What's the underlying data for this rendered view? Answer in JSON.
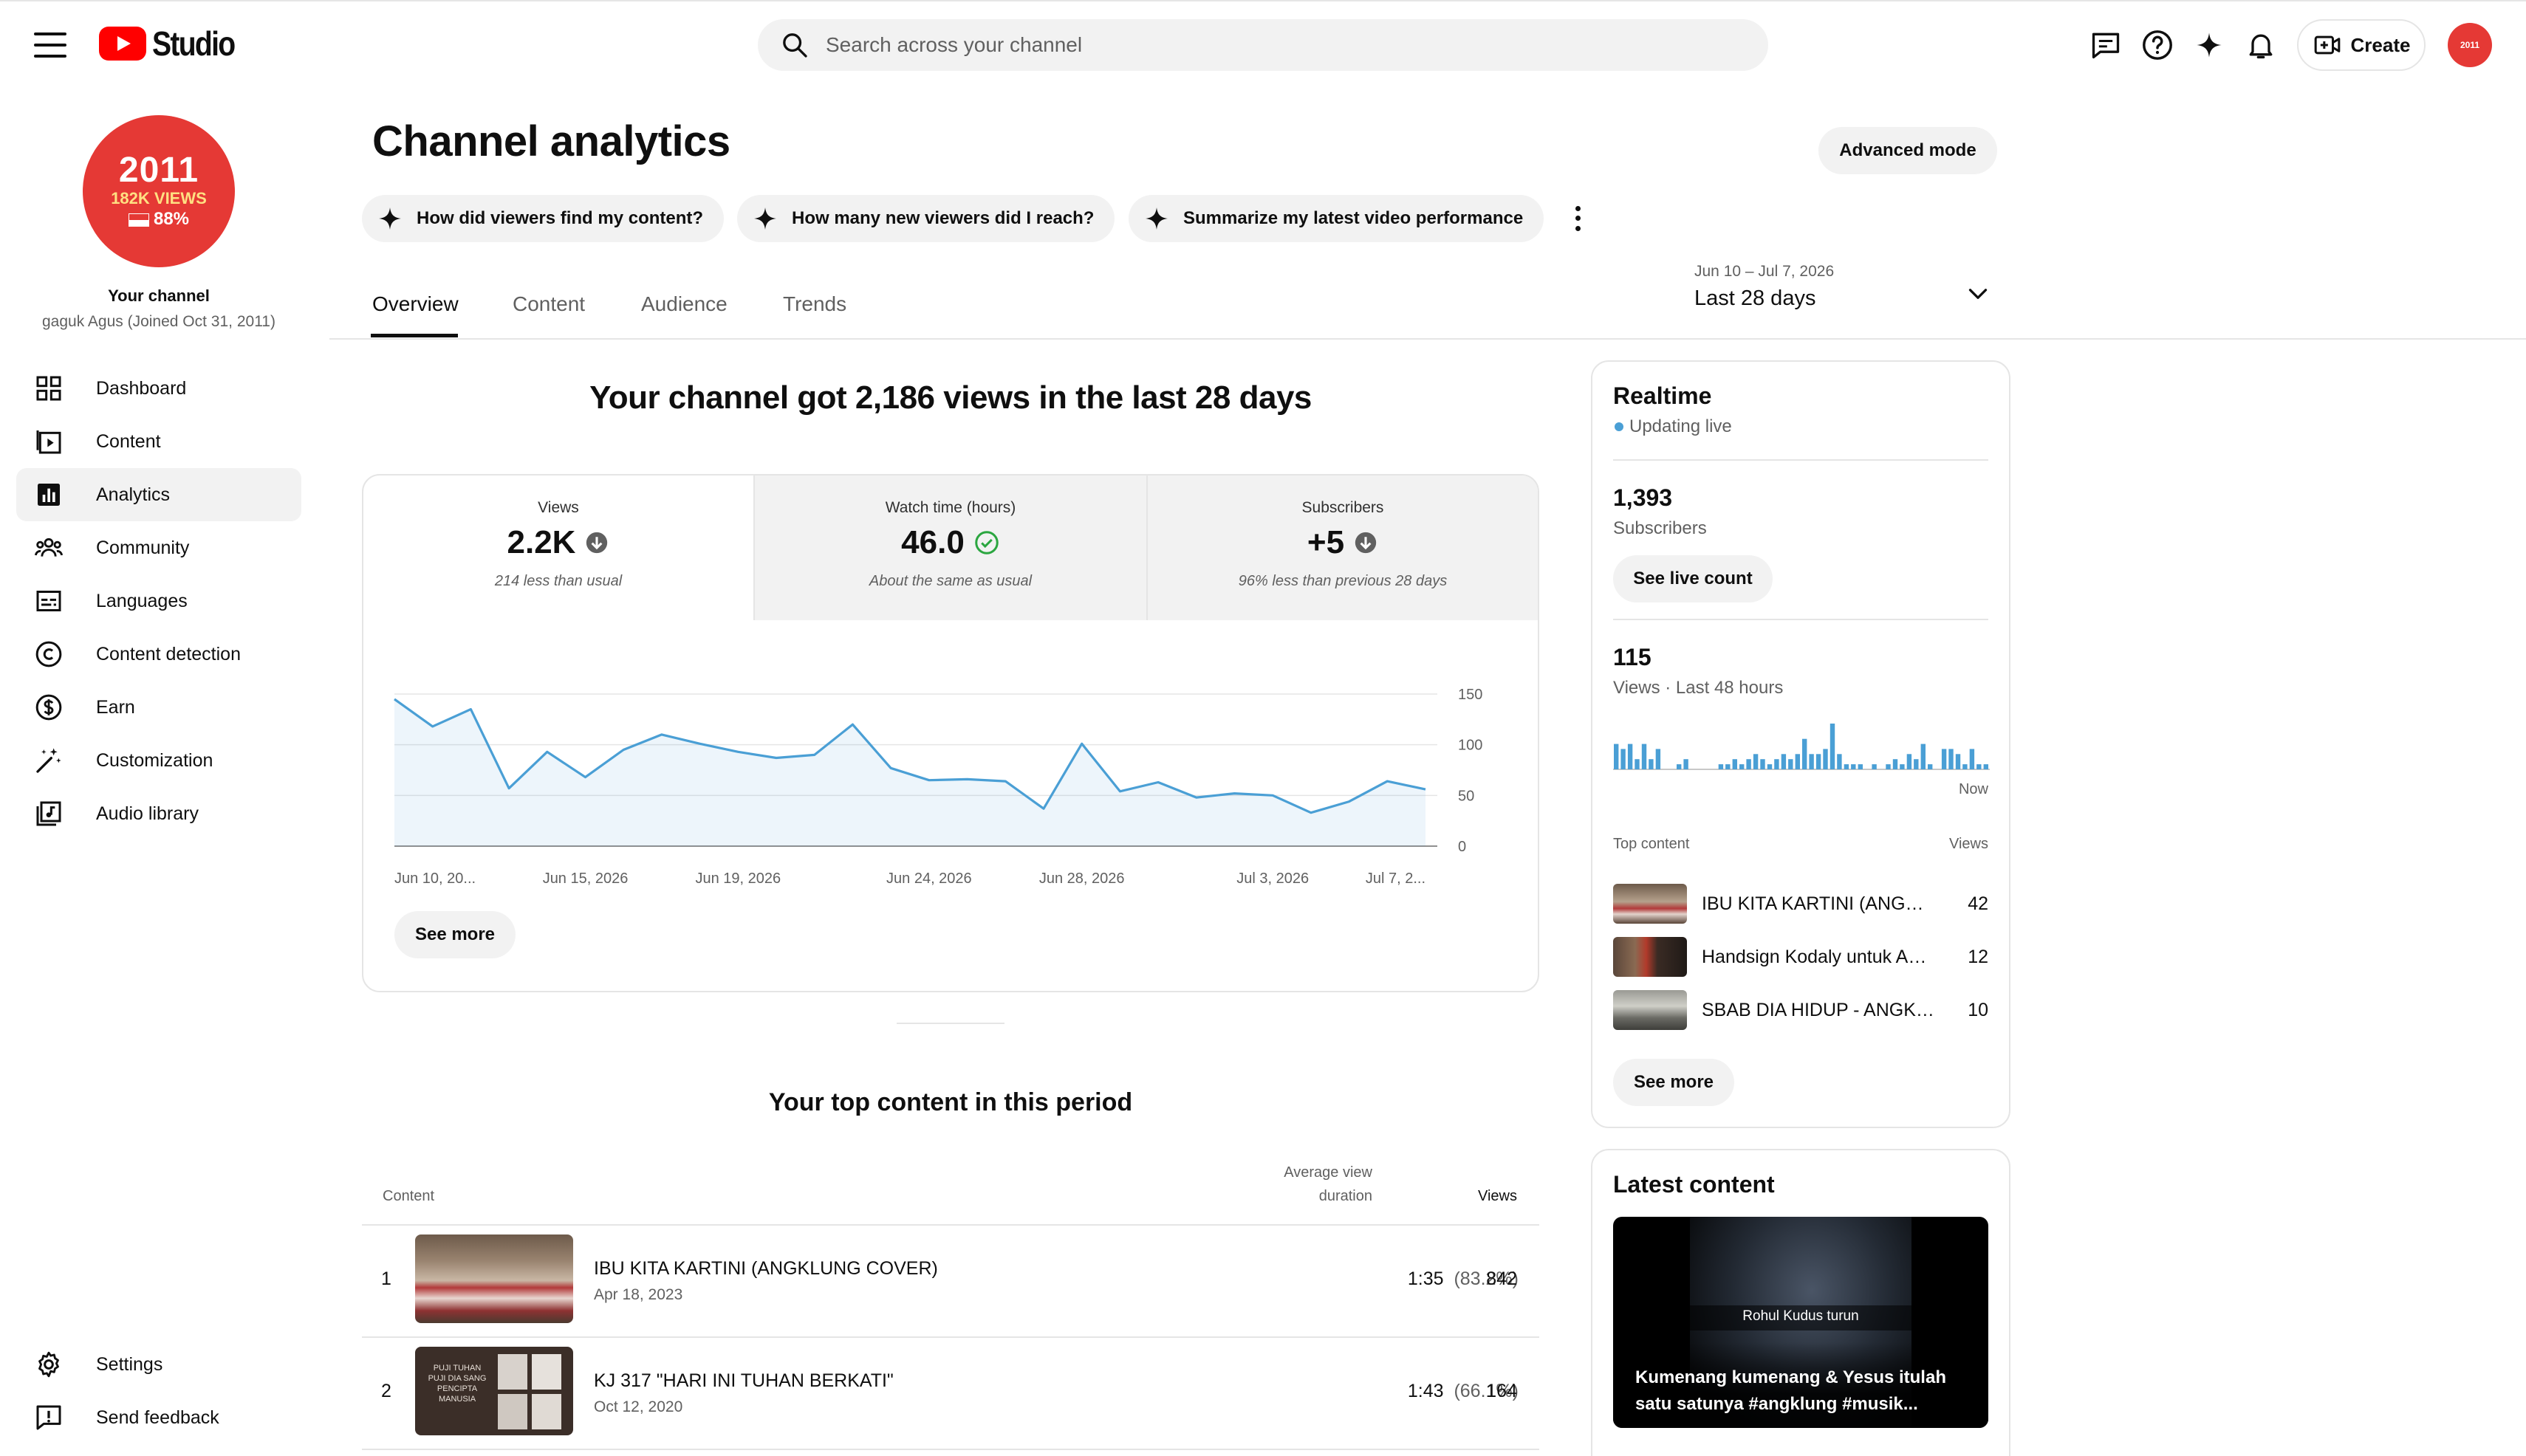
{
  "app": {
    "name": "Studio"
  },
  "search": {
    "placeholder": "Search across your channel"
  },
  "topbar": {
    "create_label": "Create",
    "avatar_text": "2011"
  },
  "channel": {
    "avatar": {
      "year": "2011",
      "views": "182K VIEWS",
      "pct": "88%"
    },
    "label": "Your channel",
    "name": "gaguk Agus (Joined Oct 31, 2011)"
  },
  "sidebar": {
    "items": [
      {
        "label": "Dashboard",
        "icon": "dashboard-icon"
      },
      {
        "label": "Content",
        "icon": "content-icon"
      },
      {
        "label": "Analytics",
        "icon": "analytics-icon",
        "active": true
      },
      {
        "label": "Community",
        "icon": "community-icon"
      },
      {
        "label": "Languages",
        "icon": "subtitles-icon"
      },
      {
        "label": "Content detection",
        "icon": "copyright-icon"
      },
      {
        "label": "Earn",
        "icon": "dollar-icon"
      },
      {
        "label": "Customization",
        "icon": "magic-wand-icon"
      },
      {
        "label": "Audio library",
        "icon": "audio-library-icon"
      }
    ],
    "footer": [
      {
        "label": "Settings",
        "icon": "gear-icon"
      },
      {
        "label": "Send feedback",
        "icon": "feedback-icon"
      }
    ]
  },
  "page": {
    "title": "Channel analytics",
    "advanced_mode": "Advanced mode",
    "chips": [
      "How did viewers find my content?",
      "How many new viewers did I reach?",
      "Summarize my latest video performance"
    ],
    "tabs": [
      "Overview",
      "Content",
      "Audience",
      "Trends"
    ],
    "date_range": {
      "range": "Jun 10 – Jul 7, 2026",
      "label": "Last 28 days"
    }
  },
  "overview": {
    "headline": "Your channel got 2,186 views in the last 28 days",
    "metrics": [
      {
        "title": "Views",
        "value": "2.2K",
        "status": "down",
        "sub": "214 less than usual"
      },
      {
        "title": "Watch time (hours)",
        "value": "46.0",
        "status": "ok",
        "sub": "About the same as usual"
      },
      {
        "title": "Subscribers",
        "value": "+5",
        "status": "down",
        "sub": "96% less than previous 28 days"
      }
    ],
    "see_more": "See more"
  },
  "chart_data": {
    "type": "area",
    "title": "",
    "xlabel": "",
    "ylabel": "",
    "x_ticks": [
      "Jun 10, 20...",
      "Jun 15, 2026",
      "Jun 19, 2026",
      "Jun 24, 2026",
      "Jun 28, 2026",
      "Jul 3, 2026",
      "Jul 7, 2..."
    ],
    "y_ticks": [
      "150",
      "100",
      "50",
      "0"
    ],
    "ylim": [
      0,
      150
    ],
    "grid": true,
    "series": [
      {
        "values": [
          145,
          118,
          135,
          57,
          93,
          68,
          95,
          110,
          101,
          93,
          87,
          90,
          120,
          77,
          65,
          66,
          64,
          37,
          101,
          54,
          63,
          48,
          52,
          50,
          33,
          44,
          64,
          56
        ]
      }
    ]
  },
  "top_content": {
    "title": "Your top content in this period",
    "headers": {
      "content": "Content",
      "avg_view_duration": "Average view duration",
      "views": "Views"
    },
    "rows": [
      {
        "rank": "1",
        "title": "IBU KITA KARTINI (ANGKLUNG COVER)",
        "date": "Apr 18, 2023",
        "duration": "1:35",
        "pct": "(83.2%)",
        "views": "842"
      },
      {
        "rank": "2",
        "title": "KJ 317 \"HARI INI TUHAN BERKATI\"",
        "date": "Oct 12, 2020",
        "duration": "1:43",
        "pct": "(66.1%)",
        "views": "164",
        "thumb_text": "PUJI TUHAN PUJI DIA SANG PENCIPTA MANUSIA"
      }
    ]
  },
  "realtime": {
    "title": "Realtime",
    "status": "Updating live",
    "subscribers_value": "1,393",
    "subscribers_label": "Subscribers",
    "live_count_btn": "See live count",
    "views_value": "115",
    "views_label": "Views · Last 48 hours",
    "now_label": "Now",
    "bars": [
      5,
      4,
      5,
      2,
      5,
      2,
      4,
      0,
      0,
      1,
      2,
      0,
      0,
      0,
      0,
      1,
      1,
      2,
      1,
      2,
      3,
      2,
      1,
      2,
      3,
      2,
      3,
      6,
      3,
      3,
      4,
      9,
      3,
      1,
      1,
      1,
      0,
      1,
      0,
      1,
      2,
      1,
      3,
      2,
      5,
      1,
      0,
      4,
      4,
      3,
      1,
      4,
      1,
      1
    ],
    "top_content_label": "Top content",
    "views_col_label": "Views",
    "items": [
      {
        "title": "IBU KITA KARTINI (ANGKLUNG COVER)",
        "views": "42"
      },
      {
        "title": "Handsign Kodaly untuk Anak",
        "views": "12"
      },
      {
        "title": "SBAB DIA HIDUP - ANGKLUNG",
        "views": "10"
      }
    ],
    "see_more": "See more"
  },
  "latest": {
    "title": "Latest content",
    "caption": "Rohul Kudus turun",
    "video_title": "Kumenang kumenang & Yesus itulah satu satunya #angklung #musik..."
  },
  "colors": {
    "accent": "#4a9fd5",
    "brand": "#ff0000",
    "ok": "#2ba640"
  }
}
